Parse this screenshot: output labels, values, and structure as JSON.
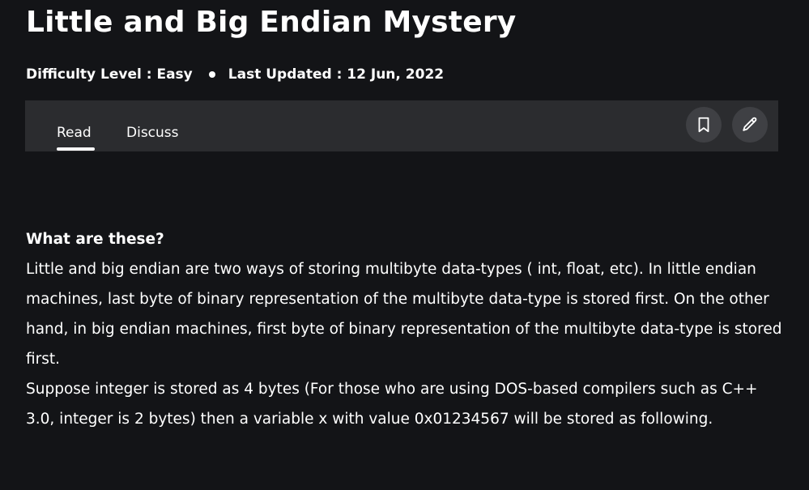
{
  "article": {
    "title": "Little and Big Endian Mystery",
    "difficulty": "Difficulty Level : Easy",
    "last_updated": "Last Updated : 12 Jun, 2022"
  },
  "tabs": {
    "read_label": "Read",
    "discuss_label": "Discuss",
    "active": "Read"
  },
  "icons": {
    "bookmark": "bookmark-icon",
    "edit": "pencil-icon"
  },
  "body": {
    "heading": "What are these?",
    "paragraph1": "Little and big endian are two ways of storing multibyte data-types ( int, float, etc). In little endian machines, last byte of binary representation of the multibyte data-type is stored first. On the other hand, in big endian machines, first byte of binary representation of the multibyte data-type is stored first.",
    "paragraph2": "Suppose integer is stored as 4 bytes (For those who are using DOS-based compilers such as C++ 3.0, integer is 2 bytes) then a variable x with value 0x01234567 will be stored as following."
  },
  "colors": {
    "background": "#131417",
    "tabbar": "#2b2c2f",
    "icon_button": "#3f4044",
    "text": "#ffffff"
  }
}
